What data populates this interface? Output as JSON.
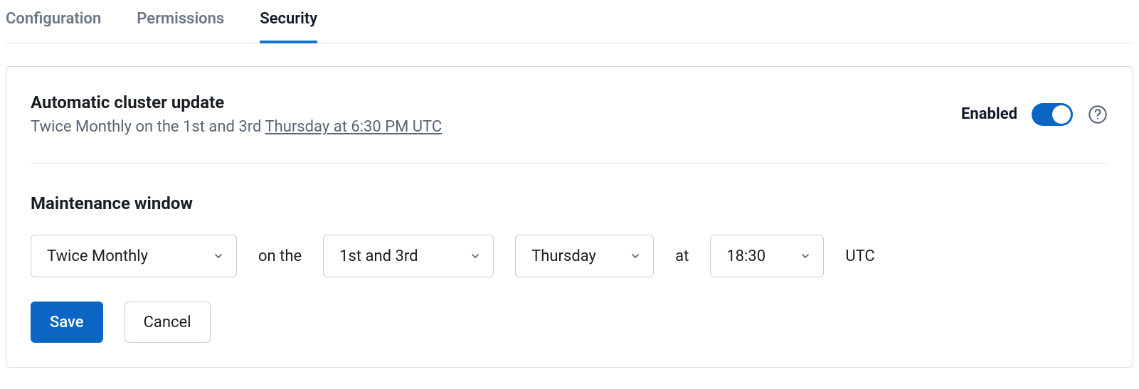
{
  "tabs": {
    "configuration": "Configuration",
    "permissions": "Permissions",
    "security": "Security"
  },
  "autoUpdate": {
    "title": "Automatic cluster update",
    "schedule_prefix": "Twice Monthly on the 1st and 3rd ",
    "schedule_link": "Thursday at 6:30 PM UTC",
    "enabled_label": "Enabled"
  },
  "maintenance": {
    "title": "Maintenance window",
    "frequency": "Twice Monthly",
    "on_the": "on the",
    "weeks": "1st and 3rd",
    "day": "Thursday",
    "at": "at",
    "time": "18:30",
    "tz": "UTC"
  },
  "buttons": {
    "save": "Save",
    "cancel": "Cancel"
  }
}
